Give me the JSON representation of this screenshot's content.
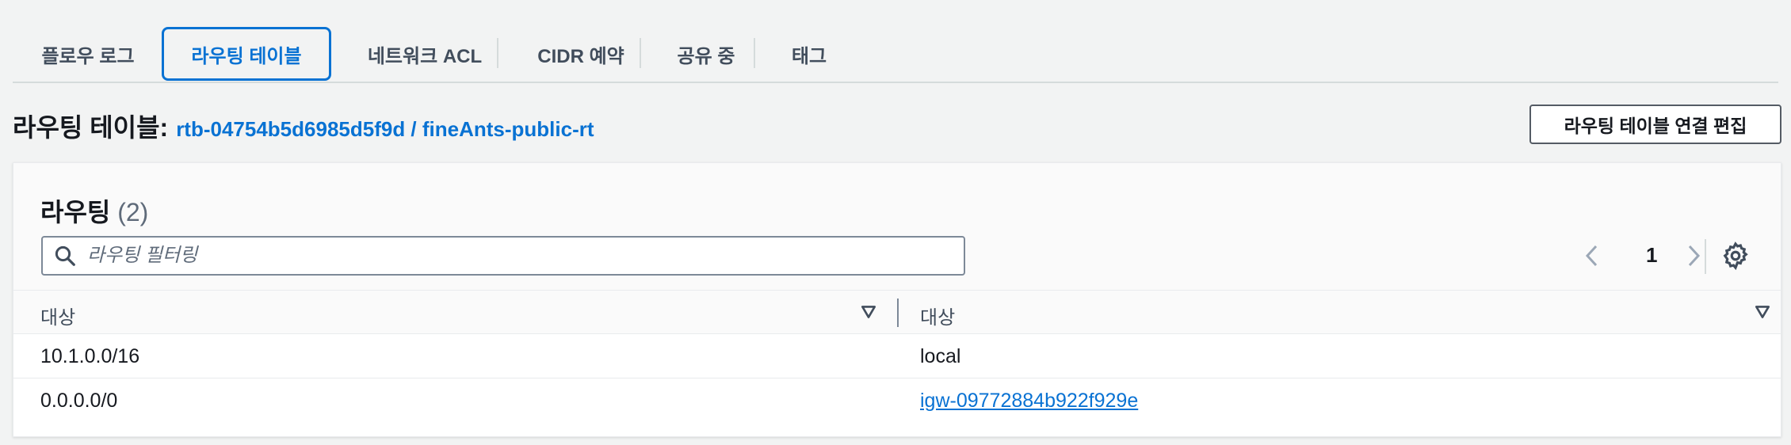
{
  "tabs": [
    {
      "label": "플로우 로그",
      "active": false
    },
    {
      "label": "라우팅 테이블",
      "active": true
    },
    {
      "label": "네트워크 ACL",
      "active": false
    },
    {
      "label": "CIDR 예약",
      "active": false
    },
    {
      "label": "공유 중",
      "active": false
    },
    {
      "label": "태그",
      "active": false
    }
  ],
  "route_table": {
    "label": "라우팅 테이블:",
    "link": "rtb-04754b5d6985d5f9d / fineAnts-public-rt",
    "edit_button": "라우팅 테이블 연결 편집"
  },
  "routes": {
    "title": "라우팅",
    "count": "(2)",
    "search_placeholder": "라우팅 필터링",
    "search_icon": "search-icon",
    "page": "1",
    "columns": [
      "대상",
      "대상"
    ],
    "rows": [
      {
        "destination": "10.1.0.0/16",
        "target": "local",
        "target_is_link": false
      },
      {
        "destination": "0.0.0.0/0",
        "target": "igw-09772884b922f929e",
        "target_is_link": true
      }
    ]
  },
  "colors": {
    "accent": "#0972d3",
    "text": "#16191f",
    "muted": "#5f6b7a",
    "background": "#f2f3f3"
  }
}
